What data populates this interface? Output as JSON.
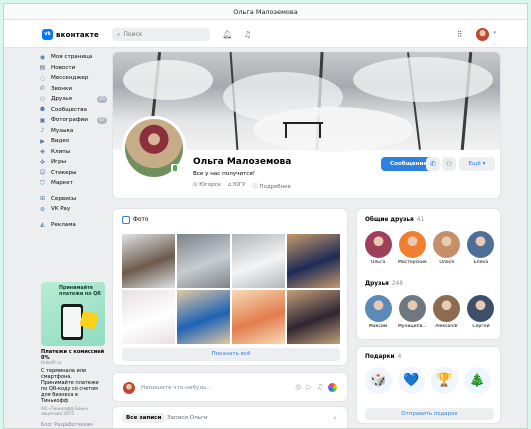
{
  "window_title": "Ольга Малоземова",
  "header": {
    "logo_text": "вконтакте",
    "logo_mark": "vk",
    "search_placeholder": "Поиск",
    "icons": [
      "bell-icon",
      "music-icon",
      "apps-grid-icon"
    ]
  },
  "sidebar": {
    "items": [
      {
        "label": "Моя страница",
        "icon": "user-icon"
      },
      {
        "label": "Новости",
        "icon": "news-icon"
      },
      {
        "label": "Мессенджер",
        "icon": "chat-icon"
      },
      {
        "label": "Звонки",
        "icon": "phone-icon"
      },
      {
        "label": "Друзья",
        "icon": "friends-icon",
        "badge": "25"
      },
      {
        "label": "Сообщества",
        "icon": "groups-icon"
      },
      {
        "label": "Фотографии",
        "icon": "photo-icon",
        "badge": "67"
      },
      {
        "label": "Музыка",
        "icon": "music-icon"
      },
      {
        "label": "Видео",
        "icon": "video-icon"
      },
      {
        "label": "Клипы",
        "icon": "clips-icon"
      },
      {
        "label": "Игры",
        "icon": "games-icon"
      },
      {
        "label": "Стикеры",
        "icon": "sticker-icon"
      },
      {
        "label": "Маркет",
        "icon": "market-icon"
      }
    ],
    "items2": [
      {
        "label": "Сервисы",
        "icon": "services-icon"
      },
      {
        "label": "VK Pay",
        "icon": "vkpay-icon"
      }
    ],
    "items3": [
      {
        "label": "Реклама",
        "icon": "ads-icon"
      }
    ]
  },
  "ad": {
    "image_text": "Принимайте платежи по QR",
    "title": "Платежи с комиссией 0%",
    "domain": "tinkoff.ru",
    "text": "С терминала или смартфона. Принимайте платежи по QR-коду со счетом для бизнеса в Тинькофф",
    "legal": "АО «Тинькофф Банк» лицензия 2673"
  },
  "footer_links": "Блог  Разработчикам",
  "profile": {
    "name": "Ольга Малоземова",
    "status": "Все у нас получится!",
    "info": [
      "Югорск",
      "ЮГУ",
      "Подробнее"
    ],
    "message_button": "Сообщение",
    "more_button": "Ещё"
  },
  "photos": {
    "tab_label": "Фото",
    "show_all": "Показать всё",
    "items": [
      {
        "name": "photo-person-winter",
        "c1": "#6d5b4c",
        "c2": "#dfe3e6"
      },
      {
        "name": "photo-snowy-fence",
        "c1": "#c7ccd0",
        "c2": "#7b838a"
      },
      {
        "name": "photo-snowy-forest",
        "c1": "#f3f4f5",
        "c2": "#b1b6ba"
      },
      {
        "name": "photo-night-sculpture",
        "c1": "#1e2b57",
        "c2": "#c79a6a"
      },
      {
        "name": "photo-drawing",
        "c1": "#ffffff",
        "c2": "#e8dfe2"
      },
      {
        "name": "photo-ugra-event",
        "c1": "#1d63b5",
        "c2": "#e2c9a3"
      },
      {
        "name": "photo-art-postcard",
        "c1": "#e37d4d",
        "c2": "#f7dcb8"
      },
      {
        "name": "photo-group-event",
        "c1": "#2f2633",
        "c2": "#c5a07a"
      }
    ]
  },
  "post_box": {
    "placeholder": "Напишите что-нибудь..."
  },
  "wall": {
    "tab_all": "Все записи",
    "tab_own": "Записи Ольги"
  },
  "mutual_friends": {
    "title": "Общие друзья",
    "count": "41",
    "people": [
      {
        "name": "Ольга",
        "c": "#9e3f5b"
      },
      {
        "name": "Мастерские",
        "c": "#f07f32"
      },
      {
        "name": "Олеся",
        "c": "#c58f6b"
      },
      {
        "name": "Елена",
        "c": "#4f6f98"
      }
    ]
  },
  "friends": {
    "title": "Друзья",
    "count": "248",
    "people": [
      {
        "name": "Максим",
        "c": "#5b89b8"
      },
      {
        "name": "Муниципа...",
        "c": "#6f7780"
      },
      {
        "name": "Aleksandr",
        "c": "#8c6b4e"
      },
      {
        "name": "Сергей",
        "c": "#3d4f6b"
      }
    ]
  },
  "gifts": {
    "title": "Подарки",
    "count": "4",
    "button": "Отправить подарок",
    "items": [
      "🎲",
      "💙",
      "🏆",
      "🎄"
    ]
  }
}
